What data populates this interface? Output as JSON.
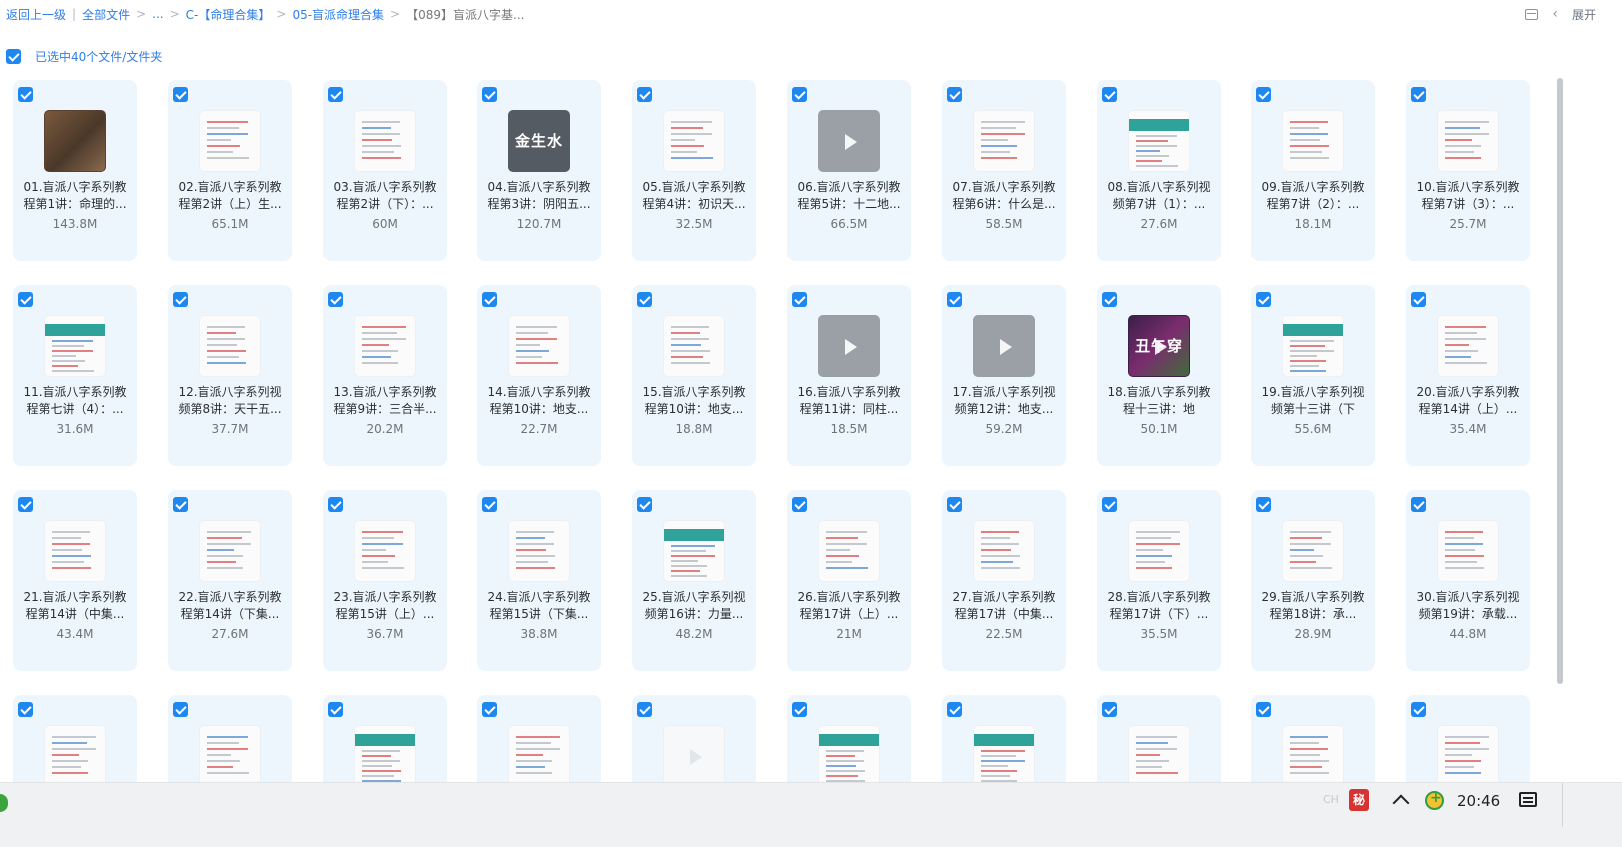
{
  "breadcrumb": {
    "back": "返回上一级",
    "all_files": "全部文件",
    "ellipsis": "...",
    "seg1": "C-【命理合集】",
    "seg2": "05-盲派命理合集",
    "current": "【089】盲派八字基..."
  },
  "header": {
    "expand": "展开",
    "list_icon": "list-view-icon",
    "chevron_icon": "chevron-left-icon"
  },
  "selection": {
    "label": "已选中40个文件/文件夹",
    "checked": true
  },
  "colors": {
    "accent": "#1e88f0",
    "link": "#2f7ee8",
    "tile_bg": "#eef6fd"
  },
  "files": [
    {
      "name": "01.盲派八字系列教程第1讲：命理的...",
      "size": "143.8M",
      "thumb": "photo"
    },
    {
      "name": "02.盲派八字系列教程第2讲（上）生...",
      "size": "65.1M",
      "thumb": "doc"
    },
    {
      "name": "03.盲派八字系列教程第2讲（下）：...",
      "size": "60M",
      "thumb": "doc"
    },
    {
      "name": "04.盲派八字系列教程第3讲：阴阳五...",
      "size": "120.7M",
      "thumb": "dark",
      "label": "金生水"
    },
    {
      "name": "05.盲派八字系列教程第4讲：初识天...",
      "size": "32.5M",
      "thumb": "doc"
    },
    {
      "name": "06.盲派八字系列教程第5讲：十二地...",
      "size": "66.5M",
      "thumb": "video"
    },
    {
      "name": "07.盲派八字系列教程第6讲：什么是...",
      "size": "58.5M",
      "thumb": "doc"
    },
    {
      "name": "08.盲派八字系列视频第7讲（1）：...",
      "size": "27.6M",
      "thumb": "teal"
    },
    {
      "name": "09.盲派八字系列教程第7讲（2）：...",
      "size": "18.1M",
      "thumb": "doc"
    },
    {
      "name": "10.盲派八字系列教程第7讲（3）：...",
      "size": "25.7M",
      "thumb": "doc"
    },
    {
      "name": "11.盲派八字系列教程第七讲（4）：...",
      "size": "31.6M",
      "thumb": "teal"
    },
    {
      "name": "12.盲派八字系列视频第8讲：天干五...",
      "size": "37.7M",
      "thumb": "doc"
    },
    {
      "name": "13.盲派八字系列教程第9讲：三合半...",
      "size": "20.2M",
      "thumb": "doc"
    },
    {
      "name": "14.盲派八字系列教程第10讲：地支...",
      "size": "22.7M",
      "thumb": "doc"
    },
    {
      "name": "15.盲派八字系列教程第10讲：地支...",
      "size": "18.8M",
      "thumb": "doc"
    },
    {
      "name": "16.盲派八字系列教程第11讲：同柱...",
      "size": "18.5M",
      "thumb": "video"
    },
    {
      "name": "17.盲派八字系列视频第12讲：地支...",
      "size": "59.2M",
      "thumb": "video"
    },
    {
      "name": "18.盲派八字系列教程十三讲：地",
      "size": "50.1M",
      "thumb": "purple",
      "label": "丑午穿"
    },
    {
      "name": "19.盲派八字系列视频第十三讲（下",
      "size": "55.6M",
      "thumb": "teal"
    },
    {
      "name": "20.盲派八字系列教程第14讲（上）...",
      "size": "35.4M",
      "thumb": "doc"
    },
    {
      "name": "21.盲派八字系列教程第14讲（中集...",
      "size": "43.4M",
      "thumb": "doc"
    },
    {
      "name": "22.盲派八字系列教程第14讲（下集...",
      "size": "27.6M",
      "thumb": "doc"
    },
    {
      "name": "23.盲派八字系列教程第15讲（上）...",
      "size": "36.7M",
      "thumb": "doc"
    },
    {
      "name": "24.盲派八字系列教程第15讲（下集...",
      "size": "38.8M",
      "thumb": "doc"
    },
    {
      "name": "25.盲派八字系列视频第16讲：力量...",
      "size": "48.2M",
      "thumb": "teal"
    },
    {
      "name": "26.盲派八字系列教程第17讲（上）...",
      "size": "21M",
      "thumb": "doc"
    },
    {
      "name": "27.盲派八字系列教程第17讲（中集...",
      "size": "22.5M",
      "thumb": "doc"
    },
    {
      "name": "28.盲派八字系列教程第17讲（下）...",
      "size": "35.5M",
      "thumb": "doc"
    },
    {
      "name": "29.盲派八字系列教程第18讲：承...",
      "size": "28.9M",
      "thumb": "doc"
    },
    {
      "name": "30.盲派八字系列视频第19讲：承载...",
      "size": "44.8M",
      "thumb": "doc"
    },
    {
      "name": "",
      "size": "",
      "thumb": "doc"
    },
    {
      "name": "",
      "size": "",
      "thumb": "doc"
    },
    {
      "name": "",
      "size": "",
      "thumb": "teal"
    },
    {
      "name": "",
      "size": "",
      "thumb": "doc"
    },
    {
      "name": "",
      "size": "",
      "thumb": "blank"
    },
    {
      "name": "",
      "size": "",
      "thumb": "teal"
    },
    {
      "name": "",
      "size": "",
      "thumb": "teal"
    },
    {
      "name": "",
      "size": "",
      "thumb": "doc"
    },
    {
      "name": "",
      "size": "",
      "thumb": "doc"
    },
    {
      "name": "",
      "size": "",
      "thumb": "doc"
    }
  ],
  "taskbar": {
    "lang": "CH",
    "ime": "秘",
    "time": "20:46"
  }
}
